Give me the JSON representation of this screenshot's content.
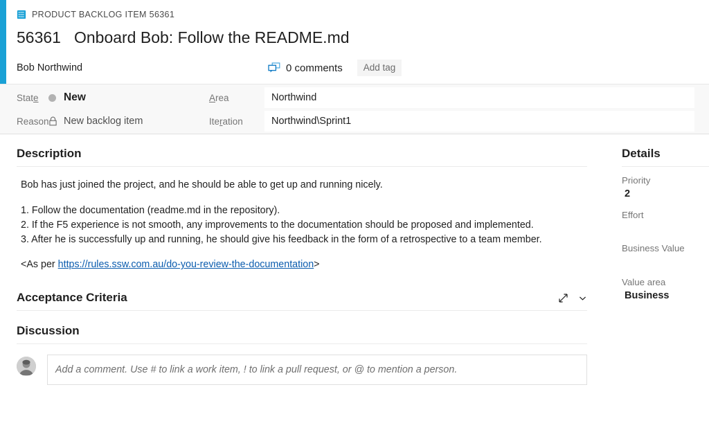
{
  "accent": {
    "work_item_blue": "#1aa1d6",
    "link_blue": "#0b5cae",
    "state_dot_gray": "#b2b2b2"
  },
  "header": {
    "type_icon": "backlog-item-icon",
    "breadcrumb": "PRODUCT BACKLOG ITEM 56361",
    "work_item_id": "56361",
    "title": "Onboard Bob: Follow the README.md",
    "assigned_to": "Bob Northwind",
    "comments_icon": "comments-icon",
    "comments_label": "0 comments",
    "add_tag_label": "Add tag"
  },
  "fields": {
    "state": {
      "label_pre": "Stat",
      "label_key": "e",
      "label_post": "",
      "value": "New",
      "icon": "state-circle-icon"
    },
    "reason": {
      "label_pre": "Reason",
      "label_key": "",
      "label_post": "",
      "value": "New backlog item",
      "icon": "lock-icon"
    },
    "area": {
      "label_pre": "",
      "label_key": "A",
      "label_post": "rea",
      "value": "Northwind"
    },
    "iteration": {
      "label_pre": "Ite",
      "label_key": "r",
      "label_post": "ation",
      "value": "Northwind\\Sprint1"
    }
  },
  "description": {
    "heading": "Description",
    "paragraph": "Bob has just joined the project, and he should be able to get up and running nicely.",
    "items": [
      "1. Follow the documentation (readme.md in the repository).",
      "2. If the F5 experience is not smooth, any improvements to the documentation should be proposed and implemented.",
      "3. After he is successfully up and running, he should give his feedback in the form of a retrospective to a team member."
    ],
    "rule_prefix": "<As per ",
    "rule_link": "https://rules.ssw.com.au/do-you-review-the-documentation",
    "rule_suffix": ">"
  },
  "acceptance": {
    "heading": "Acceptance Criteria",
    "expand_icon": "expand-icon",
    "collapse_icon": "chevron-down-icon"
  },
  "discussion": {
    "heading": "Discussion",
    "avatar": "user-avatar",
    "comment_placeholder": "Add a comment. Use # to link a work item, ! to link a pull request, or @ to mention a person."
  },
  "details": {
    "heading": "Details",
    "fields": [
      {
        "label": "Priority",
        "value": "2"
      },
      {
        "label": "Effort",
        "value": ""
      },
      {
        "label": "Business Value",
        "value": ""
      },
      {
        "label": "Value area",
        "value": "Business"
      }
    ]
  }
}
